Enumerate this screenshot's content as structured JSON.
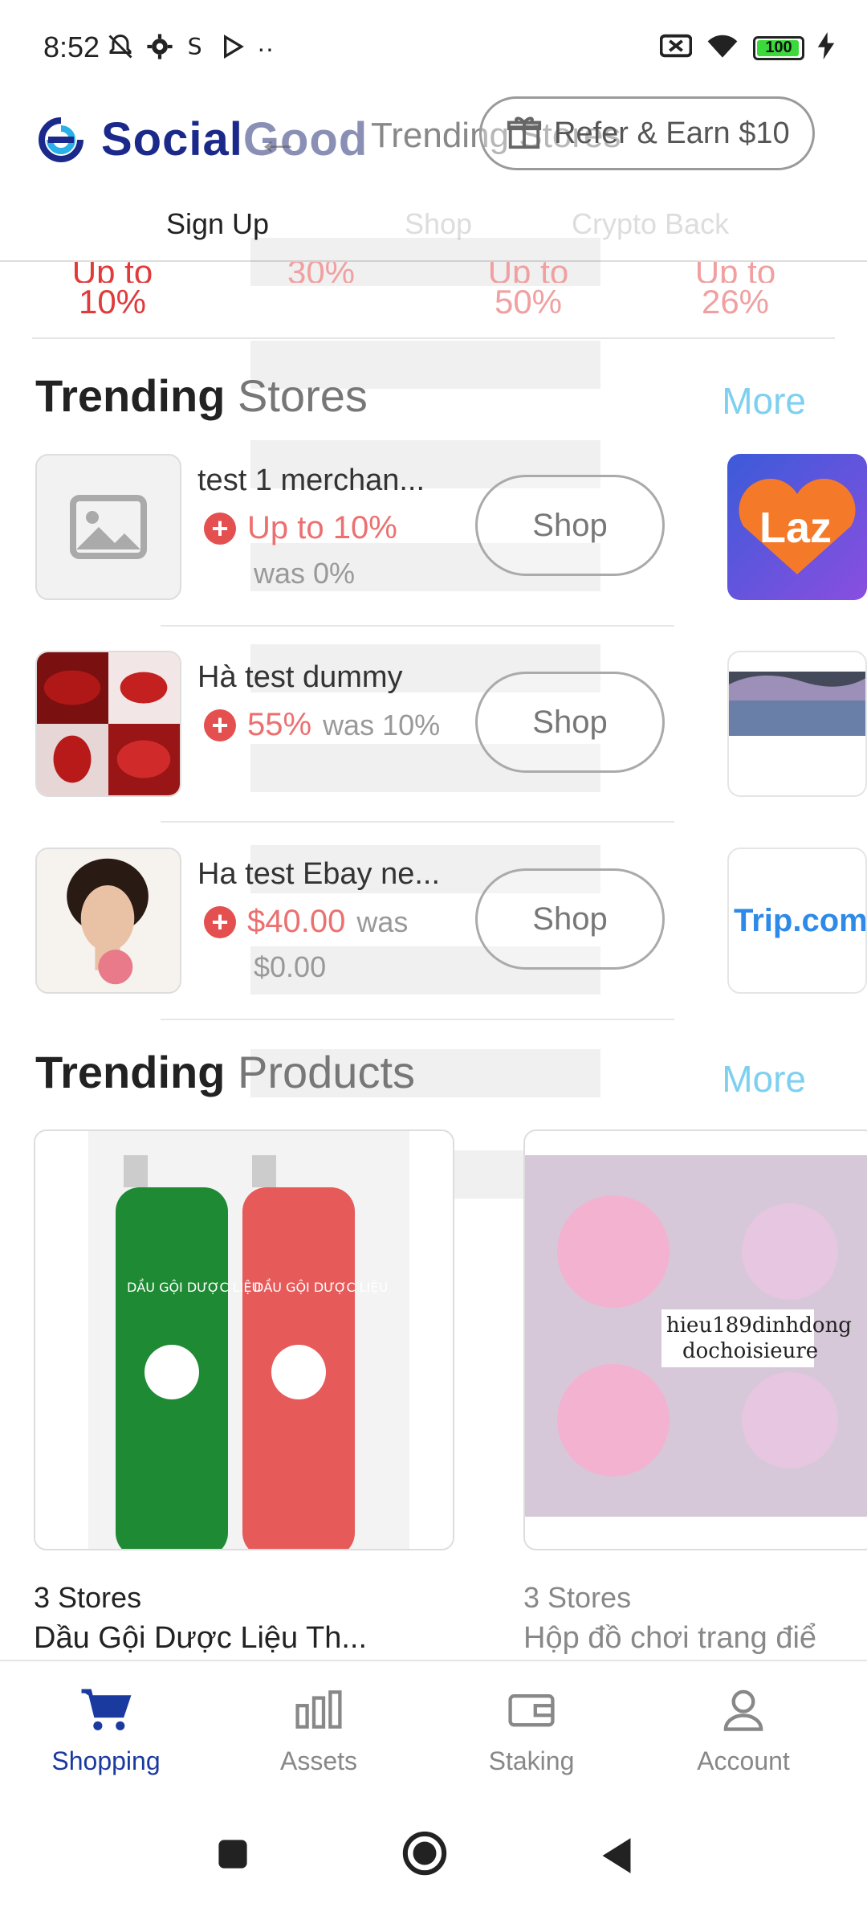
{
  "status_bar": {
    "time": "8:52",
    "battery": "100",
    "overflow": "··"
  },
  "header": {
    "logo_text_a": "Social",
    "logo_text_b": "Good",
    "ghost_title": "Trending Stores",
    "refer_label": "Refer & Earn $10"
  },
  "tabs": [
    "Sign Up",
    "Shop",
    "Crypto Back"
  ],
  "cashback_strip": [
    {
      "top": "Up to",
      "value": "10%"
    },
    {
      "top": "30%",
      "value": ""
    },
    {
      "top": "Up to",
      "value": "50%"
    },
    {
      "top": "Up to",
      "value": "26%"
    }
  ],
  "trending_stores": {
    "title_a": "Trending",
    "title_b": "Stores",
    "more": "More",
    "items": [
      {
        "name": "test 1 merchan...",
        "rate": "Up to 10%",
        "was": "was 0%",
        "shop": "Shop",
        "side": "Laz"
      },
      {
        "name": "Hà test dummy",
        "rate": "55%",
        "was": "was 10%",
        "shop": "Shop",
        "side": ""
      },
      {
        "name": "Ha test Ebay ne...",
        "rate": "$40.00",
        "was": "was",
        "was2": "$0.00",
        "shop": "Shop",
        "side": "Trip.com"
      }
    ]
  },
  "trending_products": {
    "title_a": "Trending",
    "title_b": "Products",
    "more": "More",
    "items": [
      {
        "stores": "3 Stores",
        "name": "Dầu Gội Dược Liệu Th..."
      },
      {
        "stores": "3 Stores",
        "name": "Hộp đồ chơi trang điể"
      }
    ],
    "product_text": {
      "bottle": "DẦU GỘI DƯỢC LIỆU",
      "watermark_1": "hieu189dinhdong",
      "watermark_2": "dochoisieure"
    }
  },
  "bottom_nav": [
    {
      "label": "Shopping",
      "icon": "cart-icon",
      "active": true
    },
    {
      "label": "Assets",
      "icon": "bar-chart-icon",
      "active": false
    },
    {
      "label": "Staking",
      "icon": "wallet-icon",
      "active": false
    },
    {
      "label": "Account",
      "icon": "person-icon",
      "active": false
    }
  ],
  "colors": {
    "brand": "#1b2a8a",
    "accent_red": "#e03a3a",
    "more_link": "#7dd0f0",
    "nav_active": "#1b3aa0"
  }
}
